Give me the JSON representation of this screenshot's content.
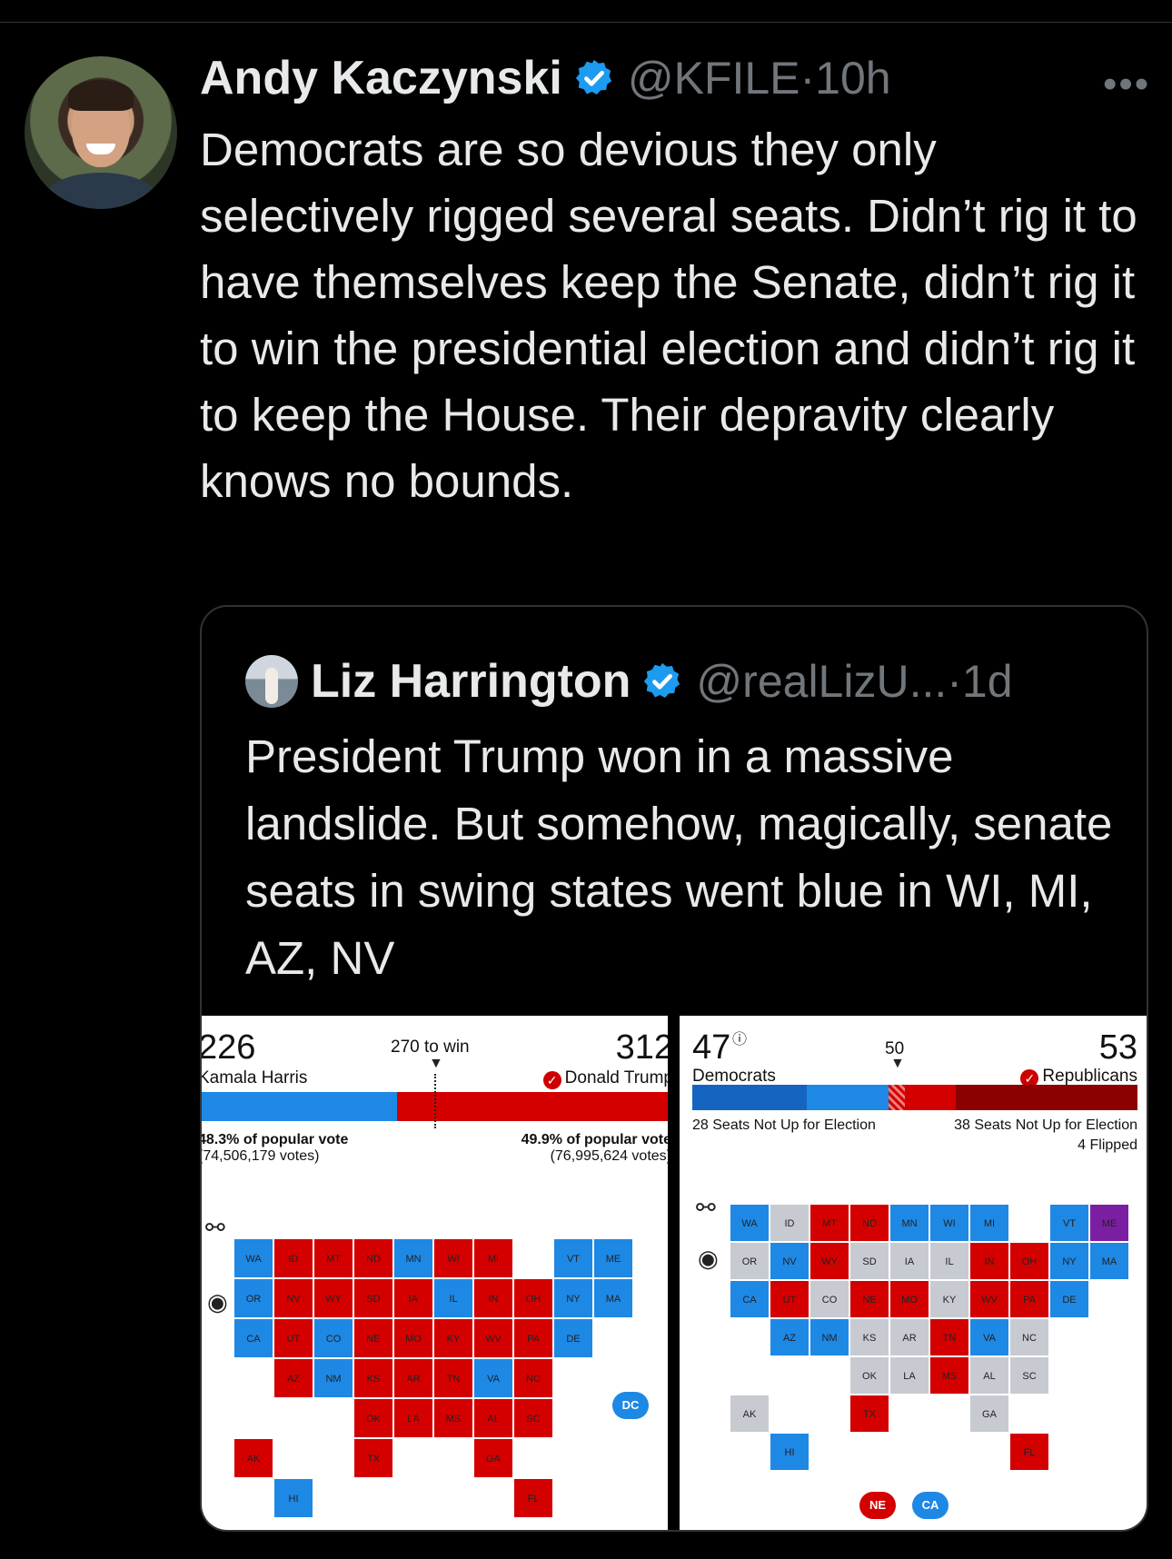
{
  "tweet": {
    "author_name": "Andy Kaczynski",
    "handle_time": "@KFILE·10h",
    "more_icon": "more-icon",
    "text": "Democrats are so devious they only selectively rigged several seats. Didn’t rig it to have themselves keep the Senate, didn’t rig it to win the presidential election and didn’t rig it to keep the House. Their depravity clearly knows no bounds."
  },
  "quote": {
    "author_name": "Liz Harrington",
    "handle_time": "@realLizU...·1d",
    "text": "President Trump won in a massive landslide. But somehow, magically, senate seats in swing states went blue in WI, MI, AZ, NV"
  },
  "colors": {
    "dem_blue": "#1e88e5",
    "rep_red": "#d40000",
    "rep_dark": "#8b0000",
    "uncontested_gray": "#c7cbd1",
    "verified_blue": "#1d9bf0"
  },
  "left_panel": {
    "dem_ev": "226",
    "dem_name": "Kamala Harris",
    "win_label": "270 to win",
    "rep_ev": "312",
    "rep_name": "Donald Trump",
    "dem_popular": "48.3% of popular vote",
    "dem_votes": "(74,506,179 votes)",
    "rep_popular": "49.9% of popular vote",
    "rep_votes": "(76,995,624 votes)",
    "dc_badge": "DC",
    "ev_share_dem": 0.42,
    "ev_share_rep": 0.58
  },
  "right_panel": {
    "dem_seats": "47",
    "dem_label": "Democrats",
    "mid_label": "50",
    "rep_seats": "53",
    "rep_label": "Republicans",
    "dem_not_up": "28 Seats Not Up for Election",
    "rep_not_up": "38 Seats Not Up for Election",
    "flipped": "4 Flipped",
    "badge_ne": "NE",
    "badge_ca": "CA"
  },
  "left_map_states": [
    {
      "abbr": "WA",
      "party": "D"
    },
    {
      "abbr": "OR",
      "party": "D"
    },
    {
      "abbr": "CA",
      "party": "D"
    },
    {
      "abbr": "NV",
      "party": "R"
    },
    {
      "abbr": "ID",
      "party": "R"
    },
    {
      "abbr": "MT",
      "party": "R"
    },
    {
      "abbr": "WY",
      "party": "R"
    },
    {
      "abbr": "UT",
      "party": "R"
    },
    {
      "abbr": "AZ",
      "party": "R"
    },
    {
      "abbr": "CO",
      "party": "D"
    },
    {
      "abbr": "NM",
      "party": "D"
    },
    {
      "abbr": "ND",
      "party": "R"
    },
    {
      "abbr": "SD",
      "party": "R"
    },
    {
      "abbr": "NE",
      "party": "R"
    },
    {
      "abbr": "KS",
      "party": "R"
    },
    {
      "abbr": "OK",
      "party": "R"
    },
    {
      "abbr": "TX",
      "party": "R"
    },
    {
      "abbr": "MN",
      "party": "D"
    },
    {
      "abbr": "IA",
      "party": "R"
    },
    {
      "abbr": "MO",
      "party": "R"
    },
    {
      "abbr": "AR",
      "party": "R"
    },
    {
      "abbr": "LA",
      "party": "R"
    },
    {
      "abbr": "WI",
      "party": "R"
    },
    {
      "abbr": "IL",
      "party": "D"
    },
    {
      "abbr": "MI",
      "party": "R"
    },
    {
      "abbr": "IN",
      "party": "R"
    },
    {
      "abbr": "OH",
      "party": "R"
    },
    {
      "abbr": "KY",
      "party": "R"
    },
    {
      "abbr": "TN",
      "party": "R"
    },
    {
      "abbr": "MS",
      "party": "R"
    },
    {
      "abbr": "AL",
      "party": "R"
    },
    {
      "abbr": "GA",
      "party": "R"
    },
    {
      "abbr": "FL",
      "party": "R"
    },
    {
      "abbr": "SC",
      "party": "R"
    },
    {
      "abbr": "NC",
      "party": "R"
    },
    {
      "abbr": "VA",
      "party": "D"
    },
    {
      "abbr": "WV",
      "party": "R"
    },
    {
      "abbr": "PA",
      "party": "R"
    },
    {
      "abbr": "NY",
      "party": "D"
    },
    {
      "abbr": "VT",
      "party": "D"
    },
    {
      "abbr": "ME",
      "party": "D"
    },
    {
      "abbr": "MA",
      "party": "D"
    },
    {
      "abbr": "DE",
      "party": "D"
    },
    {
      "abbr": "AK",
      "party": "R"
    },
    {
      "abbr": "HI",
      "party": "D"
    }
  ],
  "right_map_states": [
    {
      "abbr": "WA",
      "party": "D"
    },
    {
      "abbr": "OR",
      "party": "N"
    },
    {
      "abbr": "CA",
      "party": "D"
    },
    {
      "abbr": "NV",
      "party": "D"
    },
    {
      "abbr": "ID",
      "party": "N"
    },
    {
      "abbr": "MT",
      "party": "R"
    },
    {
      "abbr": "WY",
      "party": "R"
    },
    {
      "abbr": "UT",
      "party": "R"
    },
    {
      "abbr": "AZ",
      "party": "D"
    },
    {
      "abbr": "CO",
      "party": "N"
    },
    {
      "abbr": "NM",
      "party": "D"
    },
    {
      "abbr": "ND",
      "party": "R"
    },
    {
      "abbr": "SD",
      "party": "N"
    },
    {
      "abbr": "NE",
      "party": "R"
    },
    {
      "abbr": "KS",
      "party": "N"
    },
    {
      "abbr": "OK",
      "party": "N"
    },
    {
      "abbr": "TX",
      "party": "R"
    },
    {
      "abbr": "MN",
      "party": "D"
    },
    {
      "abbr": "IA",
      "party": "N"
    },
    {
      "abbr": "MO",
      "party": "R"
    },
    {
      "abbr": "AR",
      "party": "N"
    },
    {
      "abbr": "LA",
      "party": "N"
    },
    {
      "abbr": "WI",
      "party": "D"
    },
    {
      "abbr": "IL",
      "party": "N"
    },
    {
      "abbr": "MI",
      "party": "D"
    },
    {
      "abbr": "IN",
      "party": "R"
    },
    {
      "abbr": "OH",
      "party": "R"
    },
    {
      "abbr": "KY",
      "party": "N"
    },
    {
      "abbr": "TN",
      "party": "R"
    },
    {
      "abbr": "MS",
      "party": "R"
    },
    {
      "abbr": "AL",
      "party": "N"
    },
    {
      "abbr": "GA",
      "party": "N"
    },
    {
      "abbr": "FL",
      "party": "R"
    },
    {
      "abbr": "SC",
      "party": "N"
    },
    {
      "abbr": "NC",
      "party": "N"
    },
    {
      "abbr": "VA",
      "party": "D"
    },
    {
      "abbr": "WV",
      "party": "R"
    },
    {
      "abbr": "PA",
      "party": "R"
    },
    {
      "abbr": "NY",
      "party": "D"
    },
    {
      "abbr": "VT",
      "party": "D"
    },
    {
      "abbr": "ME",
      "party": "I"
    },
    {
      "abbr": "MA",
      "party": "D"
    },
    {
      "abbr": "DE",
      "party": "D"
    },
    {
      "abbr": "AK",
      "party": "N"
    },
    {
      "abbr": "HI",
      "party": "D"
    }
  ]
}
